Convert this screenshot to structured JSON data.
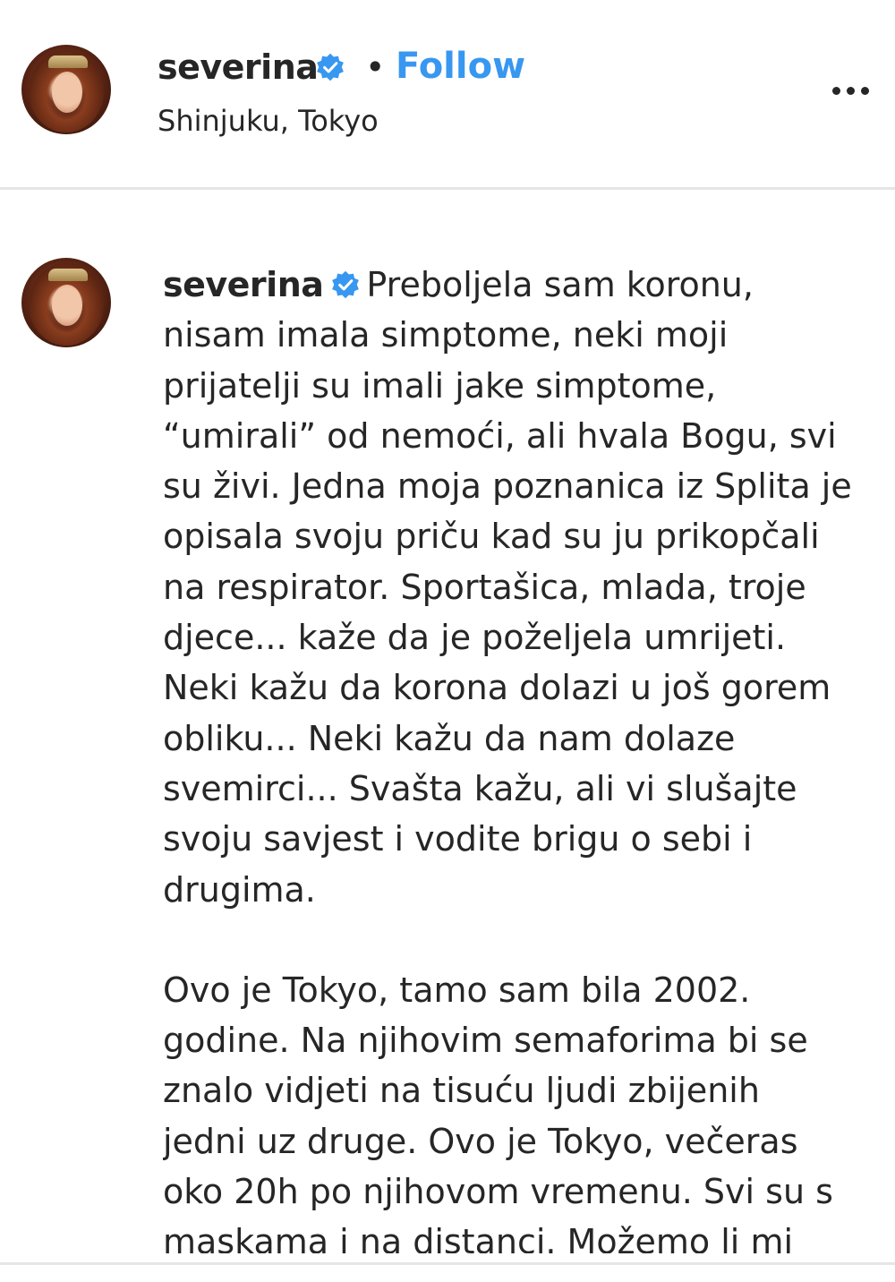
{
  "header": {
    "username": "severina",
    "separator": "•",
    "follow_label": "Follow",
    "location": "Shinjuku, Tokyo"
  },
  "caption": {
    "username": "severina",
    "paragraph1": "Preboljela sam koronu, nisam imala simptome, neki moji prijatelji su imali jake simptome, “umirali” od nemoći, ali hvala Bogu, svi su živi. Jedna moja poznanica iz Splita je opisala svoju priču kad su ju prikopčali na respirator. Sportašica, mlada, troje djece... kaže da je poželjela umrijeti. Neki kažu da korona dolazi u još gorem obliku... Neki kažu da nam dolaze svemirci... Svašta kažu, ali vi slušajte svoju savjest i vodite brigu o sebi i drugima.",
    "paragraph2": "Ovo je Tokyo, tamo sam bila 2002. godine. Na njihovim semaforima bi se znalo vidjeti na tisuću ljudi zbijenih jedni uz druge. Ovo je Tokyo, večeras oko 20h po njihovom vremenu. Svi su s maskama i na distanci. Možemo li mi"
  },
  "icons": {
    "verified": "verified-badge-icon",
    "more": "more-options-icon",
    "verified_color": "#3897f0"
  },
  "colors": {
    "accent": "#3897f0",
    "text": "#262626",
    "divider": "#e6e6e6"
  }
}
